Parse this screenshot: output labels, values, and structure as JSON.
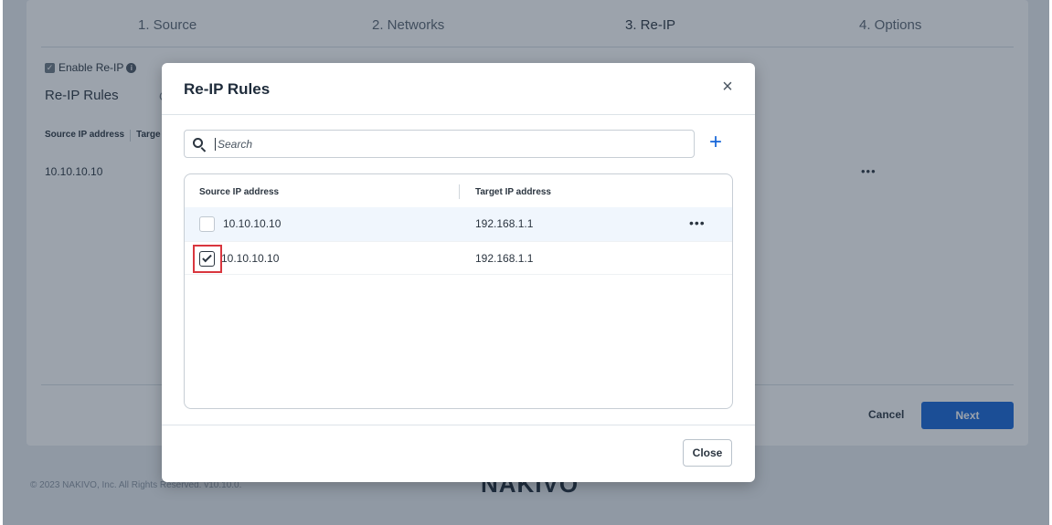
{
  "wizard": {
    "steps": [
      "1. Source",
      "2. Networks",
      "3. Re-IP",
      "4. Options"
    ],
    "active_step": 2
  },
  "background": {
    "enable_reip_label": "Enable Re-IP",
    "section_title": "Re-IP Rules",
    "section_title_trailing": "C",
    "table_headers": [
      "Source IP address",
      "Targe"
    ],
    "rows": [
      {
        "source": "10.10.10.10",
        "actions": "•••"
      }
    ],
    "cancel_label": "Cancel",
    "next_label": "Next",
    "copyright": "© 2023 NAKIVO, Inc. All Rights Reserved. v10.10.0.",
    "logo_text": "NAKIVO"
  },
  "modal": {
    "title": "Re-IP Rules",
    "close_icon": "×",
    "search": {
      "placeholder": "Search",
      "value": ""
    },
    "add_icon": "+",
    "table": {
      "headers": [
        "Source IP address",
        "Target IP address"
      ],
      "rows": [
        {
          "source": "10.10.10.10",
          "target": "192.168.1.1",
          "checked": false,
          "actions": "•••"
        },
        {
          "source": "10.10.10.10",
          "target": "192.168.1.1",
          "checked": true
        }
      ]
    },
    "close_label": "Close"
  },
  "colors": {
    "accent": "#1565d8",
    "highlight": "#d9363e",
    "overlay": "#243246"
  }
}
